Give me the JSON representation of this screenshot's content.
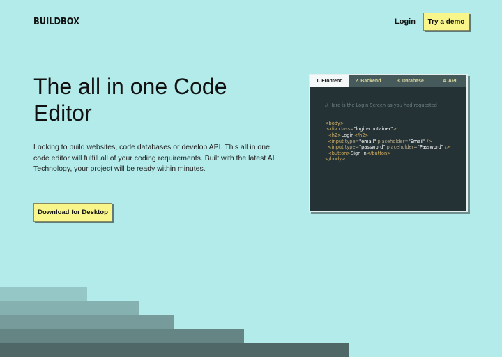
{
  "brand": {
    "name": "BUILDBOX"
  },
  "nav": {
    "login": "Login",
    "demo": "Try a demo"
  },
  "hero": {
    "title": "The all in one Code Editor",
    "description": "Looking to build websites, code databases or develop API. This all in one code editor will fulfill all of your coding requirements. Built with the latest AI Technology, your project will be ready within minutes.",
    "cta": "Download for Desktop"
  },
  "editor": {
    "tabs": [
      {
        "label": "1. Frontend",
        "active": true
      },
      {
        "label": "2. Backend",
        "active": false
      },
      {
        "label": "3. Database",
        "active": false
      },
      {
        "label": "4. API",
        "active": false
      }
    ],
    "comment": "// Here is the Login Screen as you had requested",
    "lines": {
      "l1_tag": "<body>",
      "l2_open": "<div ",
      "l2_attr": "class=",
      "l2_str": "\"login-container\"",
      "l2_close": ">",
      "l3_open": "<h2>",
      "l3_txt": "Login",
      "l3_close": "</h2>",
      "l4_open": "<input ",
      "l4_attr1": "type=",
      "l4_str1": "\"email\"",
      "l4_attr2": " placeholder=",
      "l4_str2": "\"Email\"",
      "l4_close": " />",
      "l5_open": "<input ",
      "l5_attr1": "type=",
      "l5_str1": "\"password\"",
      "l5_attr2": " placeholder=",
      "l5_str2": "\"Password\"",
      "l5_close": " />",
      "l6_open": "<button>",
      "l6_txt": "Sign In",
      "l6_close": "</button>",
      "l7_tag": "</body>"
    }
  },
  "colors": {
    "background": "#b2ebea",
    "button": "#f8f58b",
    "editor": "#243236"
  }
}
